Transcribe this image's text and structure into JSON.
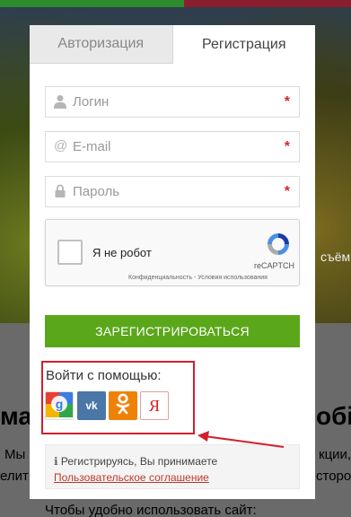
{
  "background": {
    "hero_text": "съём",
    "heading_left": "ма",
    "heading_right": "обі",
    "para_left_1": "Мы",
    "para_left_2": "елит",
    "para_right_1": "кции,",
    "para_right_2": "сторо",
    "para_bottom": "Чтобы удобно использовать сайт:"
  },
  "tabs": {
    "login": "Авторизация",
    "register": "Регистрация"
  },
  "form": {
    "login_placeholder": "Логин",
    "email_placeholder": "E-mail",
    "password_placeholder": "Пароль",
    "required_mark": "*",
    "icons": {
      "login": "user-icon",
      "email": "at-icon",
      "password": "lock-icon"
    }
  },
  "captcha": {
    "label": "Я не робот",
    "brand": "reCAPTCH",
    "links": "Конфиденциальность - Условия использования"
  },
  "submit_label": "ЗАРЕГИСТРИРОВАТЬСЯ",
  "social": {
    "label": "Войти с помощью:",
    "providers": [
      "google",
      "vk",
      "odnoklassniki",
      "yandex"
    ],
    "vk_text": "vk",
    "ya_text": "Я"
  },
  "agreement": {
    "text": "Регистрируясь, Вы принимаете",
    "link": "Пользовательское соглашение"
  },
  "colors": {
    "accent_green": "#5ba71a",
    "highlight_red": "#d21f2f",
    "link_red": "#c0392b"
  }
}
